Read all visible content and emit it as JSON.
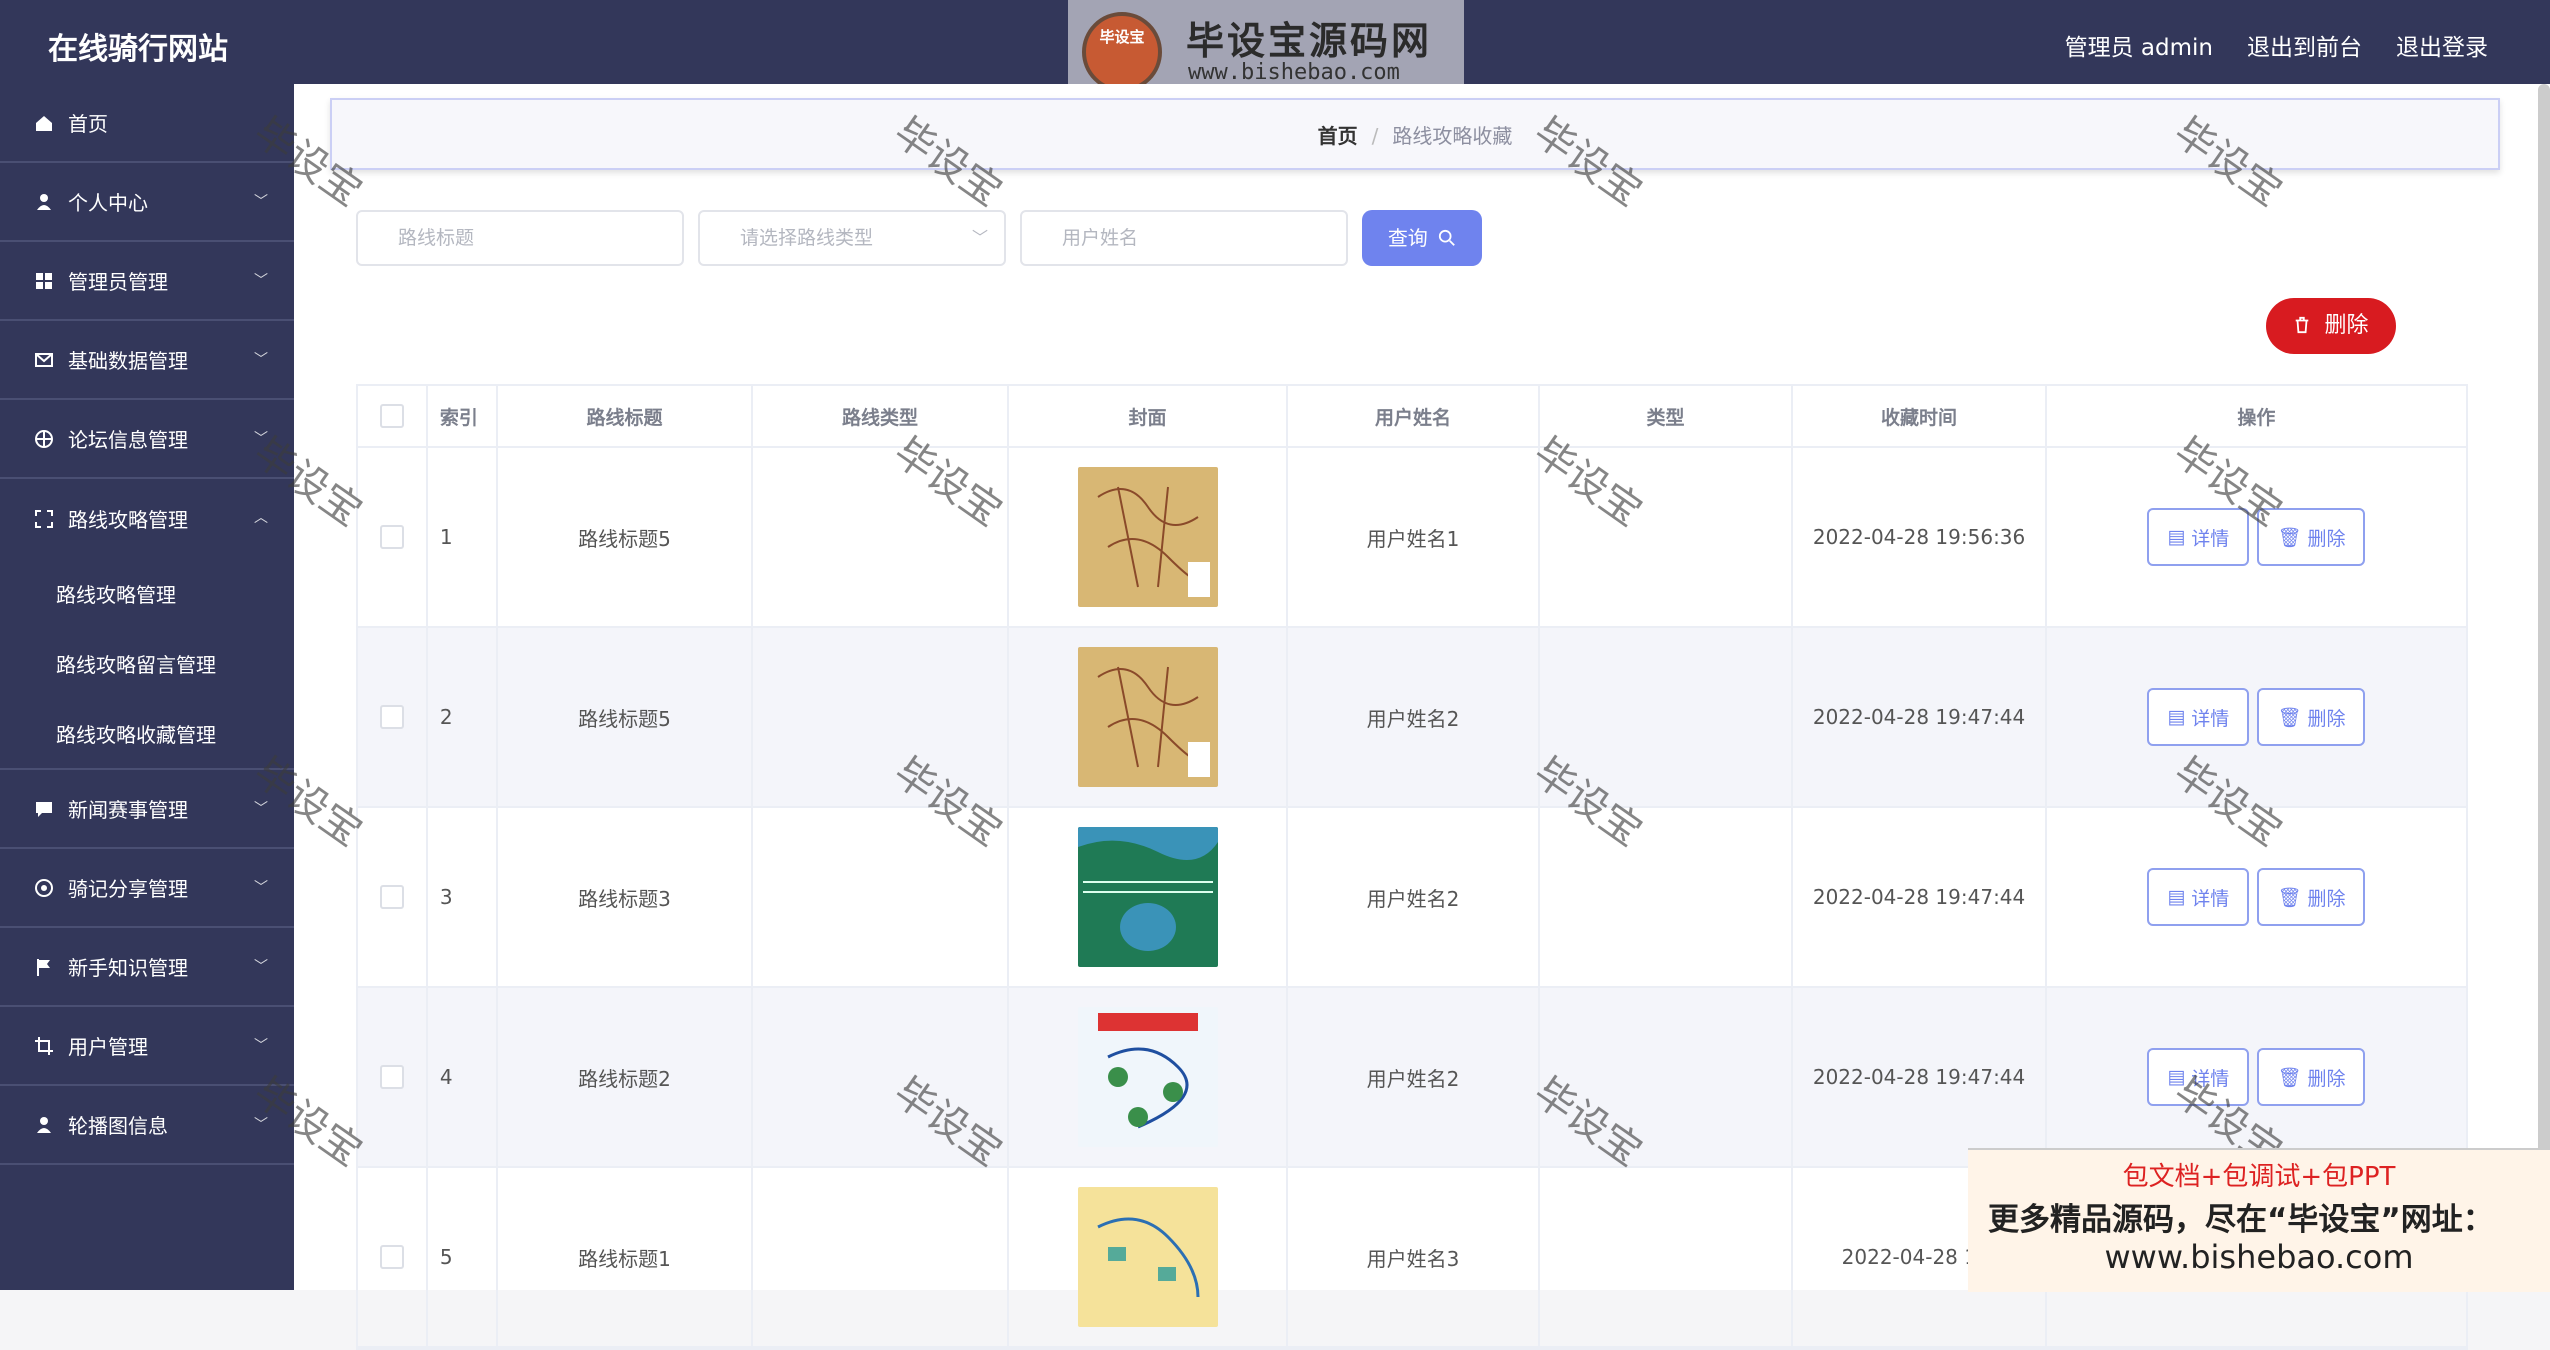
{
  "app": {
    "title": "在线骑行网站"
  },
  "header": {
    "admin_label": "管理员 admin",
    "front_label": "退出到前台",
    "logout_label": "退出登录"
  },
  "logo": {
    "badge": "毕设宝",
    "name": "毕设宝源码网",
    "url": "www.bishebao.com"
  },
  "sidebar": {
    "items": [
      {
        "label": "首页"
      },
      {
        "label": "个人中心"
      },
      {
        "label": "管理员管理"
      },
      {
        "label": "基础数据管理"
      },
      {
        "label": "论坛信息管理"
      },
      {
        "label": "路线攻略管理"
      },
      {
        "label": "新闻赛事管理"
      },
      {
        "label": "骑记分享管理"
      },
      {
        "label": "新手知识管理"
      },
      {
        "label": "用户管理"
      },
      {
        "label": "轮播图信息"
      }
    ],
    "sub_items": [
      "路线攻略管理",
      "路线攻略留言管理",
      "路线攻略收藏管理"
    ]
  },
  "breadcrumb": {
    "home": "首页",
    "current": "路线攻略收藏"
  },
  "filters": {
    "title_placeholder": "路线标题",
    "type_placeholder": "请选择路线类型",
    "user_placeholder": "用户姓名",
    "search_label": "查询"
  },
  "actions": {
    "delete_label": "删除",
    "detail_label": "详情"
  },
  "table": {
    "headers": [
      "索引",
      "路线标题",
      "路线类型",
      "封面",
      "用户姓名",
      "类型",
      "收藏时间",
      "操作"
    ],
    "rows": [
      {
        "index": "1",
        "title": "路线标题5",
        "user": "用户姓名1",
        "time": "2022-04-28 19:56:36"
      },
      {
        "index": "2",
        "title": "路线标题5",
        "user": "用户姓名2",
        "time": "2022-04-28 19:47:44"
      },
      {
        "index": "3",
        "title": "路线标题3",
        "user": "用户姓名2",
        "time": "2022-04-28 19:47:44"
      },
      {
        "index": "4",
        "title": "路线标题2",
        "user": "用户姓名2",
        "time": "2022-04-28 19:47:44"
      },
      {
        "index": "5",
        "title": "路线标题1",
        "user": "用户姓名3",
        "time": "2022-04-28 19:"
      }
    ]
  },
  "watermark": {
    "text": "毕设宝"
  },
  "ad": {
    "line1": "包文档+包调试+包PPT",
    "line2": "更多精品源码，尽在“毕设宝”网址：",
    "line3": "www.bishebao.com"
  },
  "colors": {
    "sidebar": "#33375a",
    "primary": "#6f83ee",
    "danger": "#d81b20"
  }
}
